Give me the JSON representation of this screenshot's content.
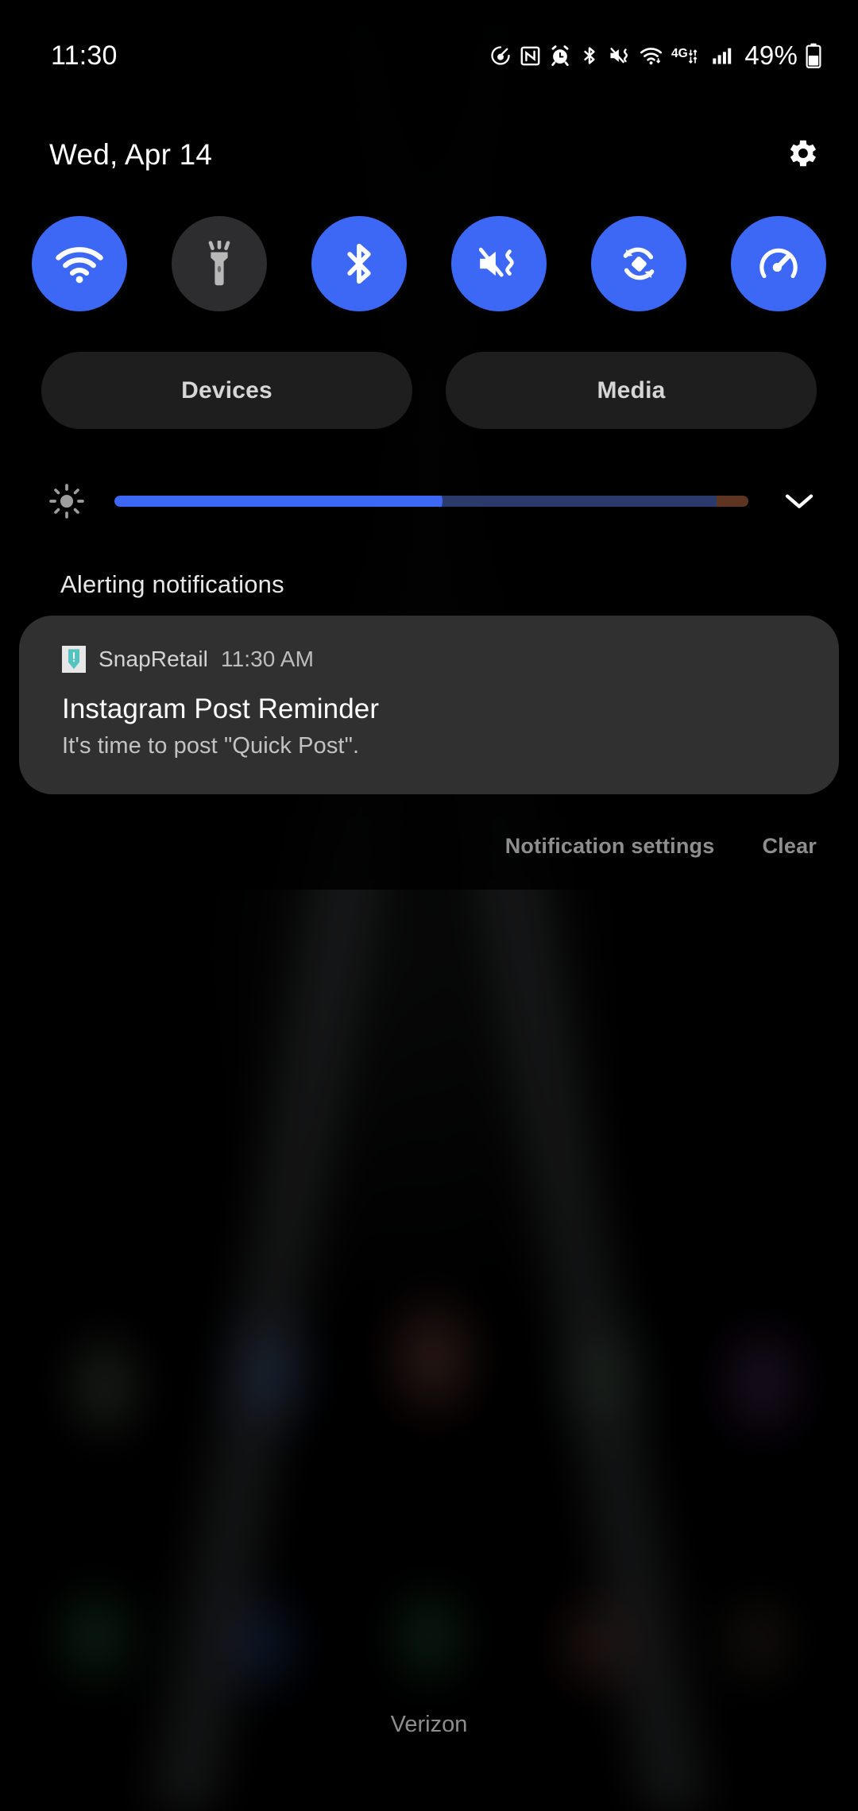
{
  "status_bar": {
    "clock": "11:30",
    "battery_percent": "49%",
    "icons": [
      {
        "name": "speedometer-icon"
      },
      {
        "name": "nfc-icon"
      },
      {
        "name": "alarm-icon"
      },
      {
        "name": "bluetooth-icon"
      },
      {
        "name": "mute-vibrate-icon"
      },
      {
        "name": "wifi-icon"
      },
      {
        "name": "network-4g-icon"
      },
      {
        "name": "signal-bars-icon"
      }
    ],
    "battery_icon": "battery-icon"
  },
  "shade": {
    "date": "Wed, Apr 14",
    "settings_icon": "gear-icon"
  },
  "quick_settings": {
    "tiles": [
      {
        "name": "wifi-tile",
        "icon": "wifi-icon",
        "state": "on"
      },
      {
        "name": "flashlight-tile",
        "icon": "flashlight-icon",
        "state": "off"
      },
      {
        "name": "bluetooth-tile",
        "icon": "bluetooth-icon",
        "state": "on"
      },
      {
        "name": "sound-mode-tile",
        "icon": "mute-vibrate-icon",
        "state": "on"
      },
      {
        "name": "auto-rotate-tile",
        "icon": "auto-rotate-icon",
        "state": "on"
      },
      {
        "name": "dashboard-tile",
        "icon": "speedometer-icon",
        "state": "on"
      }
    ],
    "devices_label": "Devices",
    "media_label": "Media"
  },
  "brightness": {
    "icon": "brightness-icon",
    "value_percent": 49,
    "expand_icon": "chevron-down-icon"
  },
  "notifications": {
    "section_header": "Alerting notifications",
    "items": [
      {
        "app_icon": "snapretail-icon",
        "app_name": "SnapRetail",
        "time": "11:30 AM",
        "title": "Instagram Post Reminder",
        "body": "It's time to post \"Quick Post\"."
      }
    ],
    "settings_label": "Notification settings",
    "clear_label": "Clear"
  },
  "home": {
    "carrier": "Verizon"
  },
  "colors": {
    "accent_blue": "#3d68f5",
    "tile_off": "#2d2d2f",
    "card_bg": "#303030",
    "app_icon_teal": "#57c3c0"
  }
}
